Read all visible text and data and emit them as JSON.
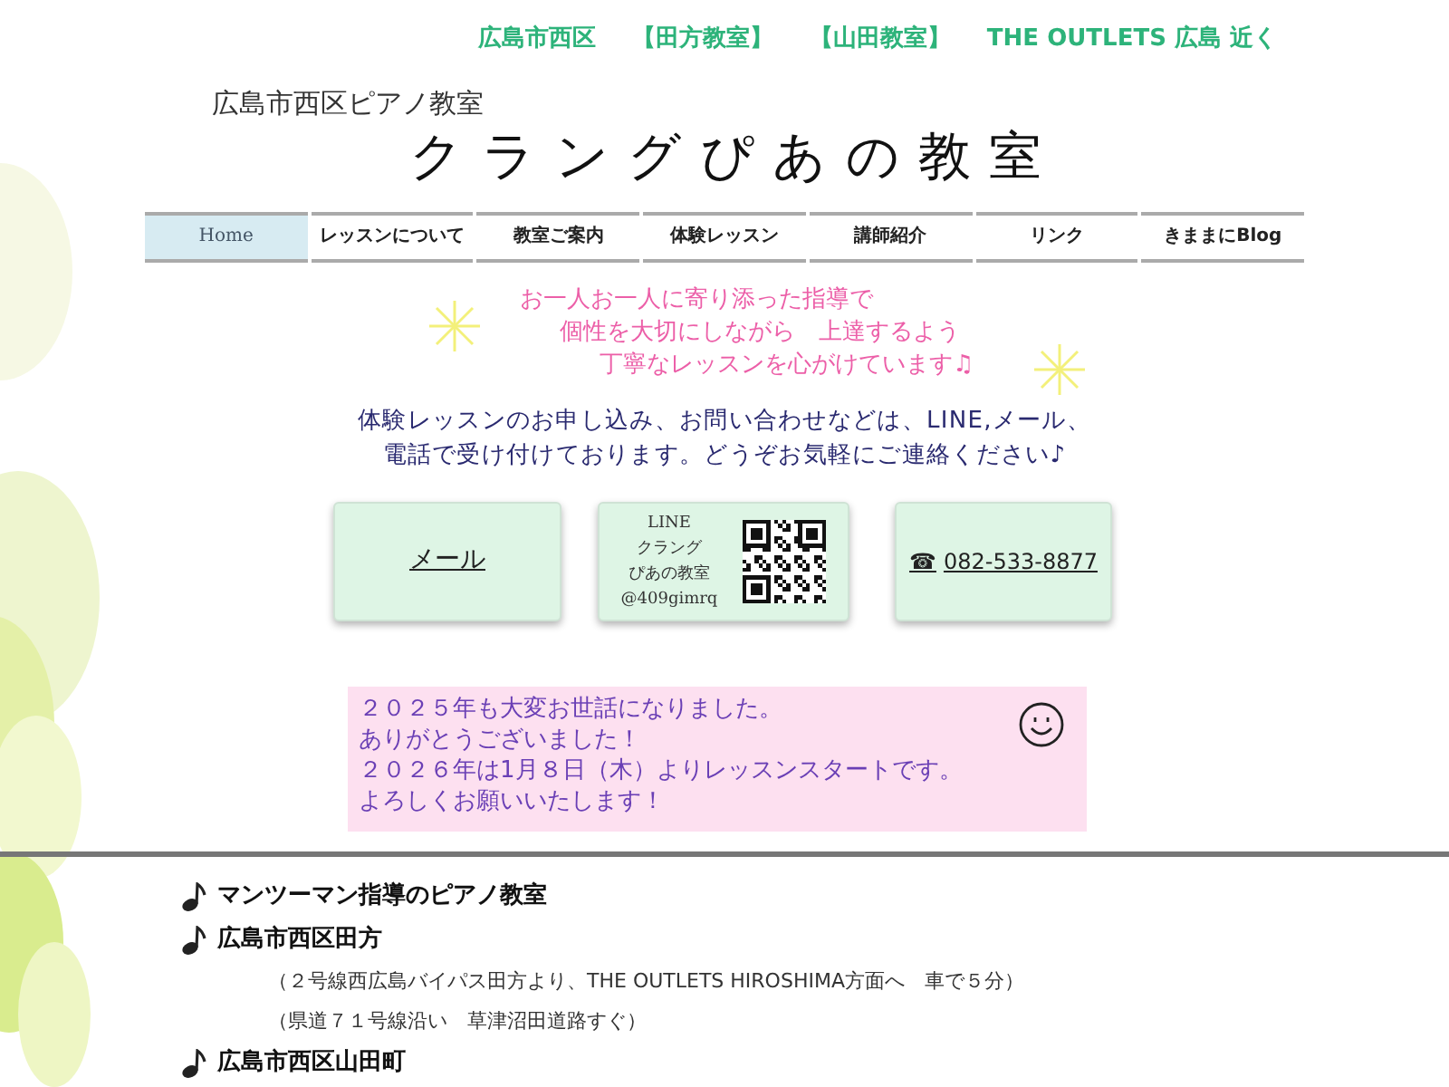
{
  "top_links": [
    "広島市西区",
    "【田方教室】",
    "【山田教室】",
    "THE OUTLETS 広島 近く"
  ],
  "header": {
    "subtitle": "広島市西区ピアノ教室",
    "title": "クラングぴあの教室"
  },
  "nav": [
    {
      "label": "Home",
      "selected": true
    },
    {
      "label": "レッスンについて",
      "selected": false
    },
    {
      "label": "教室ご案内",
      "selected": false
    },
    {
      "label": "体験レッスン",
      "selected": false
    },
    {
      "label": "講師紹介",
      "selected": false
    },
    {
      "label": "リンク",
      "selected": false
    },
    {
      "label": "きままにBlog",
      "selected": false
    }
  ],
  "tagline": [
    "お一人お一人に寄り添った指導で",
    "個性を大切にしながら　上達するよう",
    "丁寧なレッスンを心がけています♫"
  ],
  "contact_text": [
    "体験レッスンのお申し込み、お問い合わせなどは、LINE,メール、",
    "電話で受け付けております。どうぞお気軽にご連絡ください♪"
  ],
  "contact_cards": [
    {
      "kind": "link",
      "label": "メール"
    },
    {
      "kind": "line",
      "lines": [
        "LINE",
        "クラング",
        "ぴあの教室",
        "@409gimrq"
      ]
    },
    {
      "kind": "phone",
      "icon": "☎",
      "label": "082-533-8877"
    }
  ],
  "notice": [
    "２０２５年も大変お世話になりました。",
    "ありがとうございました！",
    "２０２６年は1月８日（木）よりレッスンスタートです。",
    "よろしくお願いいたします！"
  ],
  "features": [
    {
      "title": "マンツーマン指導のピアノ教室"
    },
    {
      "title": "広島市西区田方",
      "notes": [
        "（２号線西広島バイパス田方より、THE OUTLETS HIROSHIMA方面へ　車で５分）",
        "（県道７１号線沿い　草津沼田道路すぐ）"
      ]
    },
    {
      "title": "広島市西区山田町"
    }
  ]
}
